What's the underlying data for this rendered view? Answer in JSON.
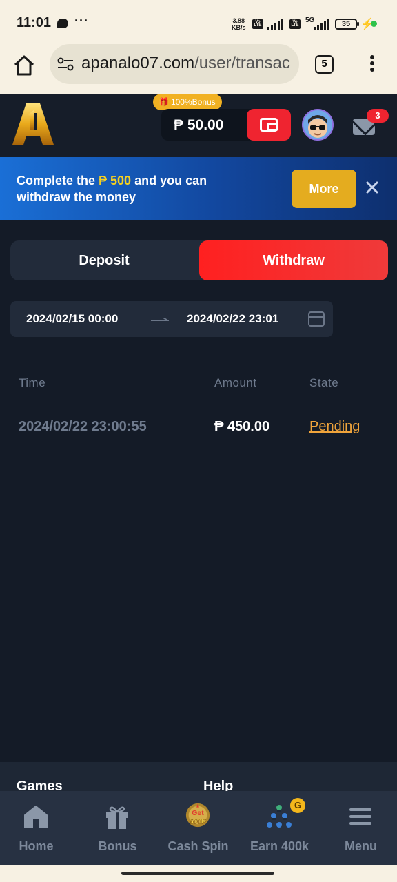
{
  "status_bar": {
    "time": "11:01",
    "net_speed_value": "3.88",
    "net_speed_unit": "KB/s",
    "volte": "Vo LTE",
    "network_type": "5G",
    "battery": "35"
  },
  "browser": {
    "url_host": "apanalo07.com",
    "url_path": "/user/transac",
    "tab_count": "5"
  },
  "header": {
    "bonus_tag": "100%Bonus",
    "balance": "₱ 50.00",
    "mail_badge_count": "3"
  },
  "promo": {
    "text_before": "Complete the ",
    "highlight": "₱ 500",
    "text_after": " and you can withdraw the money",
    "more_label": "More"
  },
  "tabs": {
    "deposit": "Deposit",
    "withdraw": "Withdraw",
    "active": "withdraw"
  },
  "date_range": {
    "start": "2024/02/15 00:00",
    "end": "2024/02/22 23:01"
  },
  "table": {
    "columns": [
      "Time",
      "Amount",
      "State"
    ],
    "rows": [
      {
        "time": "2024/02/22 23:00:55",
        "amount": "₱ 450.00",
        "state": "Pending"
      }
    ]
  },
  "footer": {
    "links": [
      "Games",
      "Help"
    ]
  },
  "bottom_nav": {
    "items": [
      {
        "label": "Home",
        "icon": "home-icon"
      },
      {
        "label": "Bonus",
        "icon": "gift-icon"
      },
      {
        "label": "Cash Spin",
        "icon": "cash-spin-icon",
        "icon_text_top": "Get",
        "icon_text_bottom": "500P"
      },
      {
        "label": "Earn 400k",
        "icon": "referral-network-icon",
        "badge": "G"
      },
      {
        "label": "Menu",
        "icon": "menu-icon"
      }
    ]
  },
  "colors": {
    "accent_red": "#ef2430",
    "gold": "#e4ac1f",
    "pending": "#f0a43b",
    "background": "#141b27"
  }
}
